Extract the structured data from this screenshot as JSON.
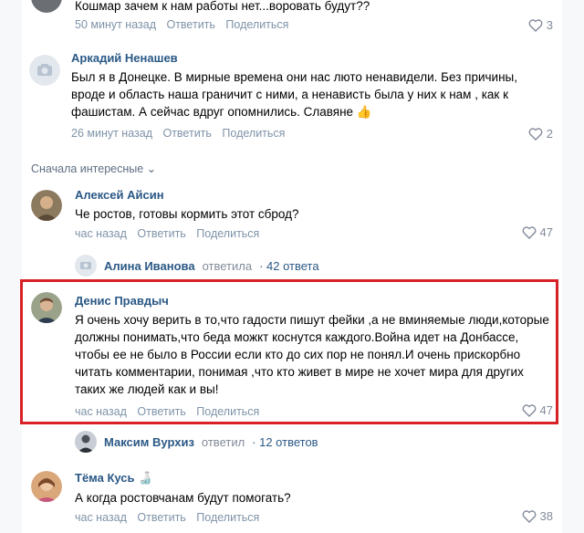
{
  "comments": [
    {
      "id": "c0",
      "author": "",
      "text": "Кошмар зачем к нам работы нет...воровать будут??",
      "time": "50 минут назад",
      "reply": "Ответить",
      "share": "Поделиться",
      "likes": "3"
    },
    {
      "id": "c1",
      "author": "Аркадий Ненашев",
      "text": "Был я в Донецке. В мирные времена они нас люто ненавидели. Без причины, вроде и область наша граничит с ними, а ненависть была у них к нам , как к фашистам. А сейчас вдруг опомнились. Славяне 👍",
      "time": "26 минут назад",
      "reply": "Ответить",
      "share": "Поделиться",
      "likes": "2"
    },
    {
      "id": "c2",
      "author": "Алексей Айсин",
      "text": "Че ростов, готовы кормить этот сброд?",
      "time": "час назад",
      "reply": "Ответить",
      "share": "Поделиться",
      "likes": "47"
    },
    {
      "id": "c3",
      "author": "Денис Правдыч",
      "text": "Я очень хочу верить в то,что гадости пишут фейки ,а не вминяемые люди,которые должны понимать,что беда можкт коснутся каждого.Война идет на Донбассе, чтобы ее не было в России если кто до сих пор не понял.И очень прискорбно читать комментарии, понимая ,что кто живет в мире не хочет мира для других таких же людей как и вы!",
      "time": "час назад",
      "reply": "Ответить",
      "share": "Поделиться",
      "likes": "47"
    },
    {
      "id": "c4",
      "author": "Тёма Кусь 🍶",
      "text": "А когда ростовчанам будут помогать?",
      "time": "час назад",
      "reply": "Ответить",
      "share": "Поделиться",
      "likes": "38"
    }
  ],
  "sort_label": "Сначала интересные ⌄",
  "replies": [
    {
      "name": "Алина Иванова",
      "verb": "ответила",
      "count": "· 42 ответа"
    },
    {
      "name": "Максим Вурхиз",
      "verb": "ответил",
      "count": "· 12 ответов"
    }
  ],
  "colors": {
    "link": "#2a5885",
    "meta": "#7f93a8",
    "highlight": "#d82126"
  }
}
